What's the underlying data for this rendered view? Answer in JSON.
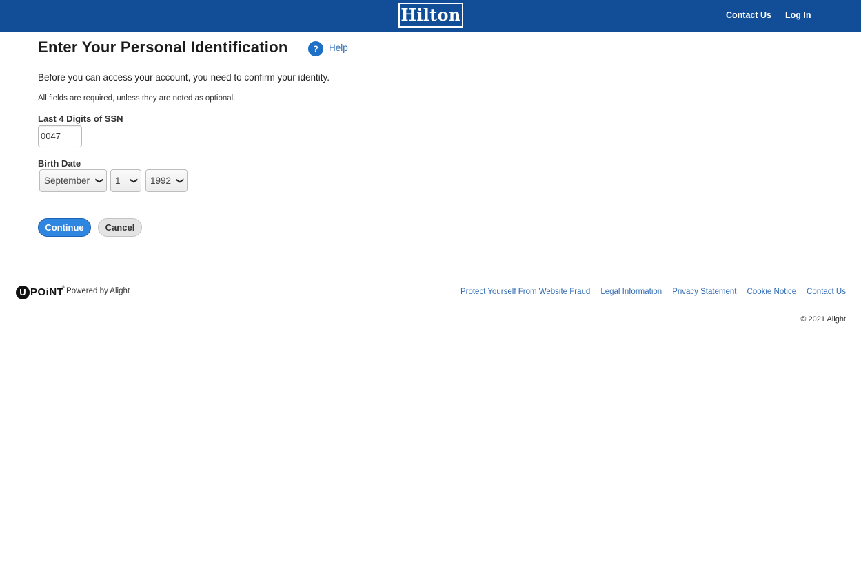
{
  "header": {
    "logo_text": "Hilton",
    "contact_label": "Contact Us",
    "login_label": "Log In",
    "bg_color": "#124e97"
  },
  "page": {
    "title": "Enter Your Personal Identification",
    "help_icon": "?",
    "help_label": "Help",
    "intro": "Before you can access your account, you need to confirm your identity.",
    "note": "All fields are required, unless they are noted as optional."
  },
  "form": {
    "ssn_label": "Last 4 Digits of SSN",
    "ssn_value": "0047",
    "birth_label": "Birth Date",
    "month": "September",
    "day": "1",
    "year": "1992",
    "continue_label": "Continue",
    "cancel_label": "Cancel"
  },
  "footer": {
    "brand_u": "U",
    "brand_rest": "POiNT",
    "brand_tm": "®",
    "powered": "Powered by Alight",
    "links": [
      "Protect Yourself From Website Fraud",
      "Legal Information",
      "Privacy Statement",
      "Cookie Notice",
      "Contact Us"
    ],
    "copyright": "© 2021 Alight"
  },
  "colors": {
    "primary_button": "#2f86e0",
    "link": "#2f6bb3"
  }
}
